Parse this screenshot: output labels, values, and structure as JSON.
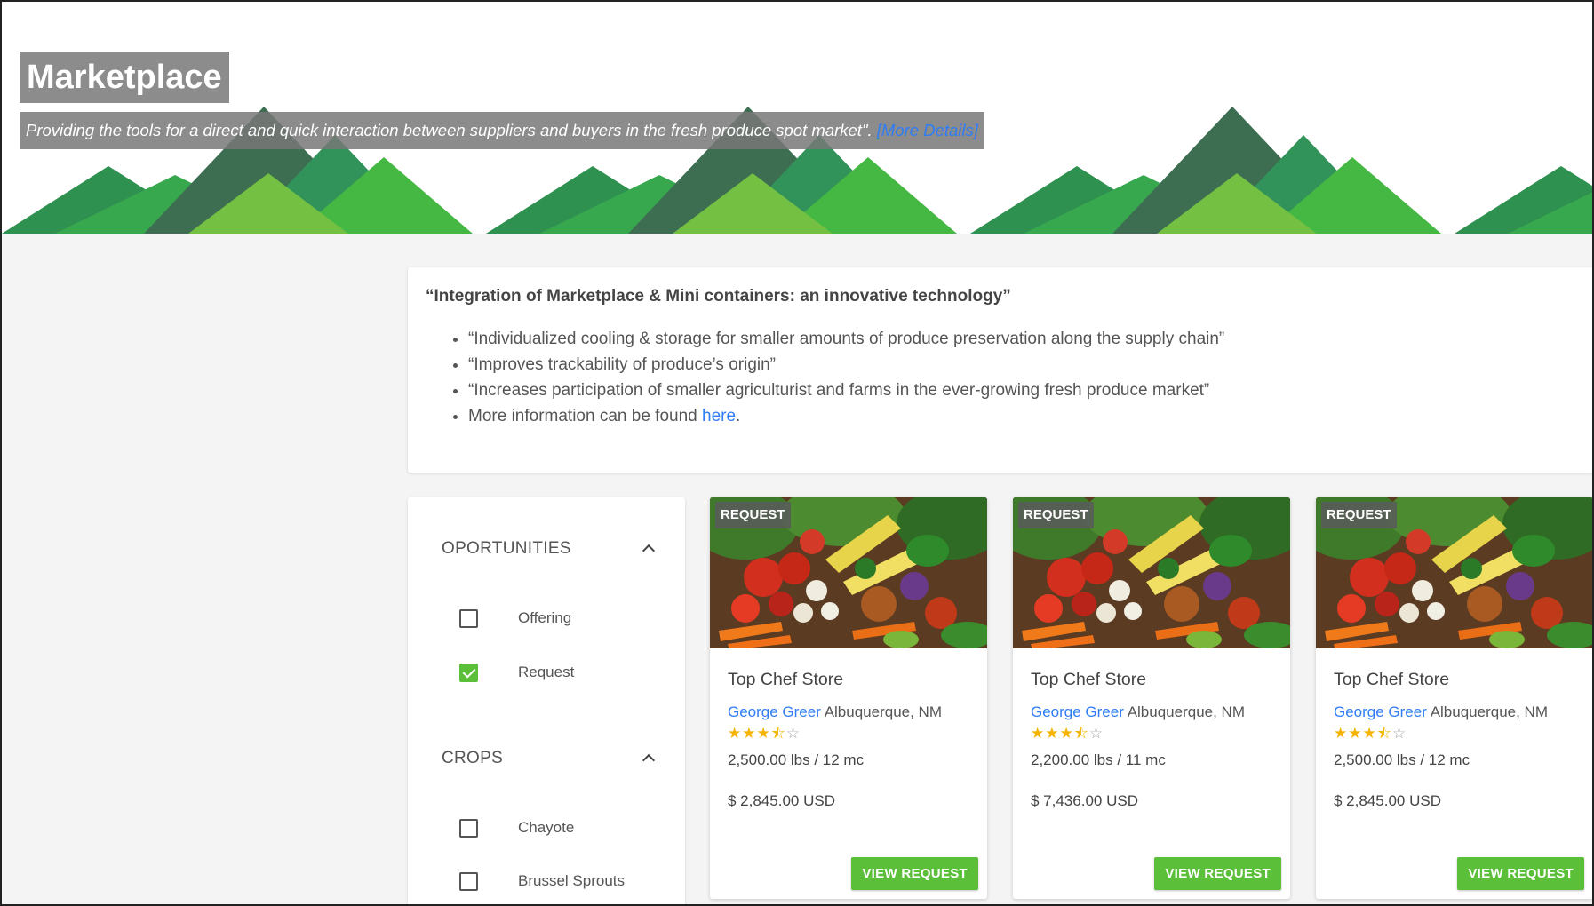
{
  "hero": {
    "title": "Marketplace",
    "subtitle": "Providing the tools for a direct and quick interaction between suppliers and buyers in the fresh produce spot market\".",
    "more_link": "[More Details]"
  },
  "info": {
    "heading": "“Integration of Marketplace & Mini containers: an innovative technology”",
    "bullets": [
      "“Individualized cooling & storage for smaller amounts of produce preservation along the supply chain”",
      "“Improves trackability of produce’s origin”",
      "“Increases participation of smaller agriculturist and farms in the ever-growing fresh produce market”"
    ],
    "more_text": "More information can be found ",
    "more_link": "here",
    "more_suffix": "."
  },
  "filters": {
    "opportunities": {
      "title": "OPORTUNITIES",
      "options": [
        {
          "label": "Offering",
          "checked": false
        },
        {
          "label": "Request",
          "checked": true
        }
      ]
    },
    "crops": {
      "title": "CROPS",
      "options": [
        {
          "label": "Chayote",
          "checked": false
        },
        {
          "label": "Brussel Sprouts",
          "checked": false
        }
      ]
    }
  },
  "listings": [
    {
      "badge": "REQUEST",
      "store": "Top Chef Store",
      "seller": "George Greer",
      "location": "Albuquerque, NM",
      "rating": 3.5,
      "quantity": "2,500.00 lbs / 12 mc",
      "price": "$ 2,845.00 USD",
      "button": "VIEW REQUEST"
    },
    {
      "badge": "REQUEST",
      "store": "Top Chef Store",
      "seller": "George Greer",
      "location": "Albuquerque, NM",
      "rating": 3.5,
      "quantity": "2,200.00 lbs / 11 mc",
      "price": "$ 7,436.00 USD",
      "button": "VIEW REQUEST"
    },
    {
      "badge": "REQUEST",
      "store": "Top Chef Store",
      "seller": "George Greer",
      "location": "Albuquerque, NM",
      "rating": 3.5,
      "quantity": "2,500.00 lbs / 12 mc",
      "price": "$ 2,845.00 USD",
      "button": "VIEW REQUEST"
    }
  ],
  "colors": {
    "accent": "#5cbf3a",
    "link": "#2f7cf6",
    "star": "#f4b400"
  }
}
